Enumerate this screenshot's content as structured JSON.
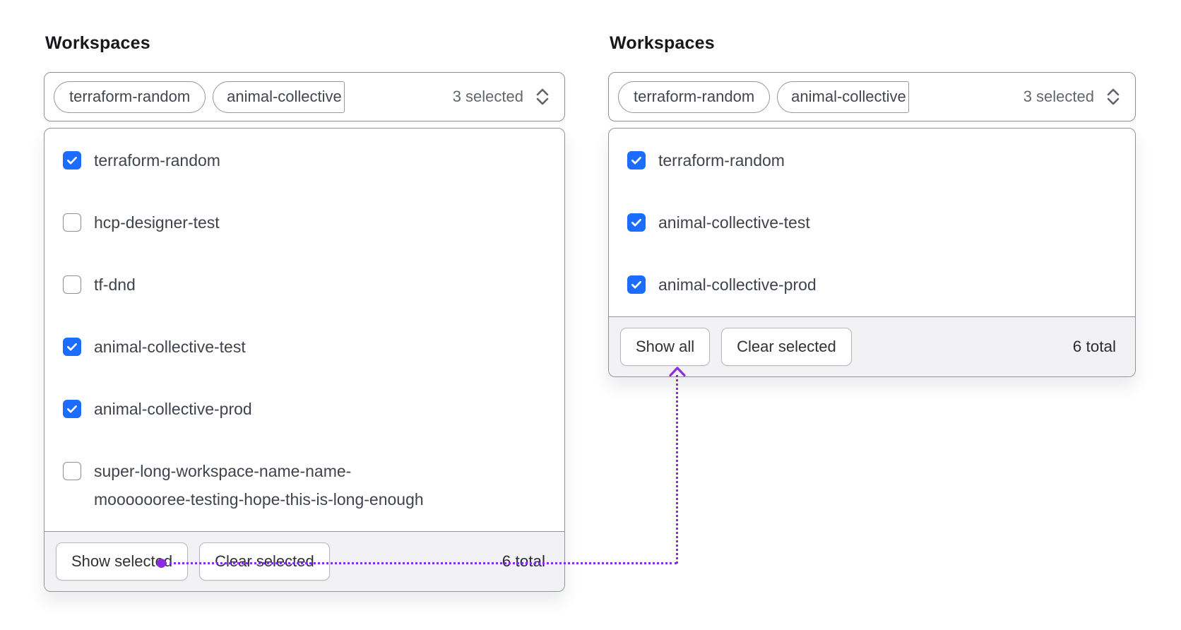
{
  "colors": {
    "checkbox_blue": "#1b6cff",
    "annotation_purple": "#8b2ce0"
  },
  "icons": {
    "toggle_chevron": "chevron-up-down-icon",
    "checkbox_check": "check-icon",
    "annotation_arrow": "arrow-up-icon"
  },
  "left_panel": {
    "title": "Workspaces",
    "toggle": {
      "tags": [
        "terraform-random",
        "animal-collective"
      ],
      "summary": "3 selected"
    },
    "options": [
      {
        "label": "terraform-random",
        "checked": true
      },
      {
        "label": "hcp-designer-test",
        "checked": false
      },
      {
        "label": "tf-dnd",
        "checked": false
      },
      {
        "label": "animal-collective-test",
        "checked": true
      },
      {
        "label": "animal-collective-prod",
        "checked": true
      },
      {
        "label": "super-long-workspace-name-name-\nmooooooree-testing-hope-this-is-long-enough",
        "checked": false
      }
    ],
    "footer": {
      "show_button": "Show selected",
      "clear_button": "Clear selected",
      "total": "6 total"
    }
  },
  "right_panel": {
    "title": "Workspaces",
    "toggle": {
      "tags": [
        "terraform-random",
        "animal-collective"
      ],
      "summary": "3 selected"
    },
    "options": [
      {
        "label": "terraform-random",
        "checked": true
      },
      {
        "label": "animal-collective-test",
        "checked": true
      },
      {
        "label": "animal-collective-prod",
        "checked": true
      }
    ],
    "footer": {
      "show_button": "Show all",
      "clear_button": "Clear selected",
      "total": "6 total"
    }
  }
}
